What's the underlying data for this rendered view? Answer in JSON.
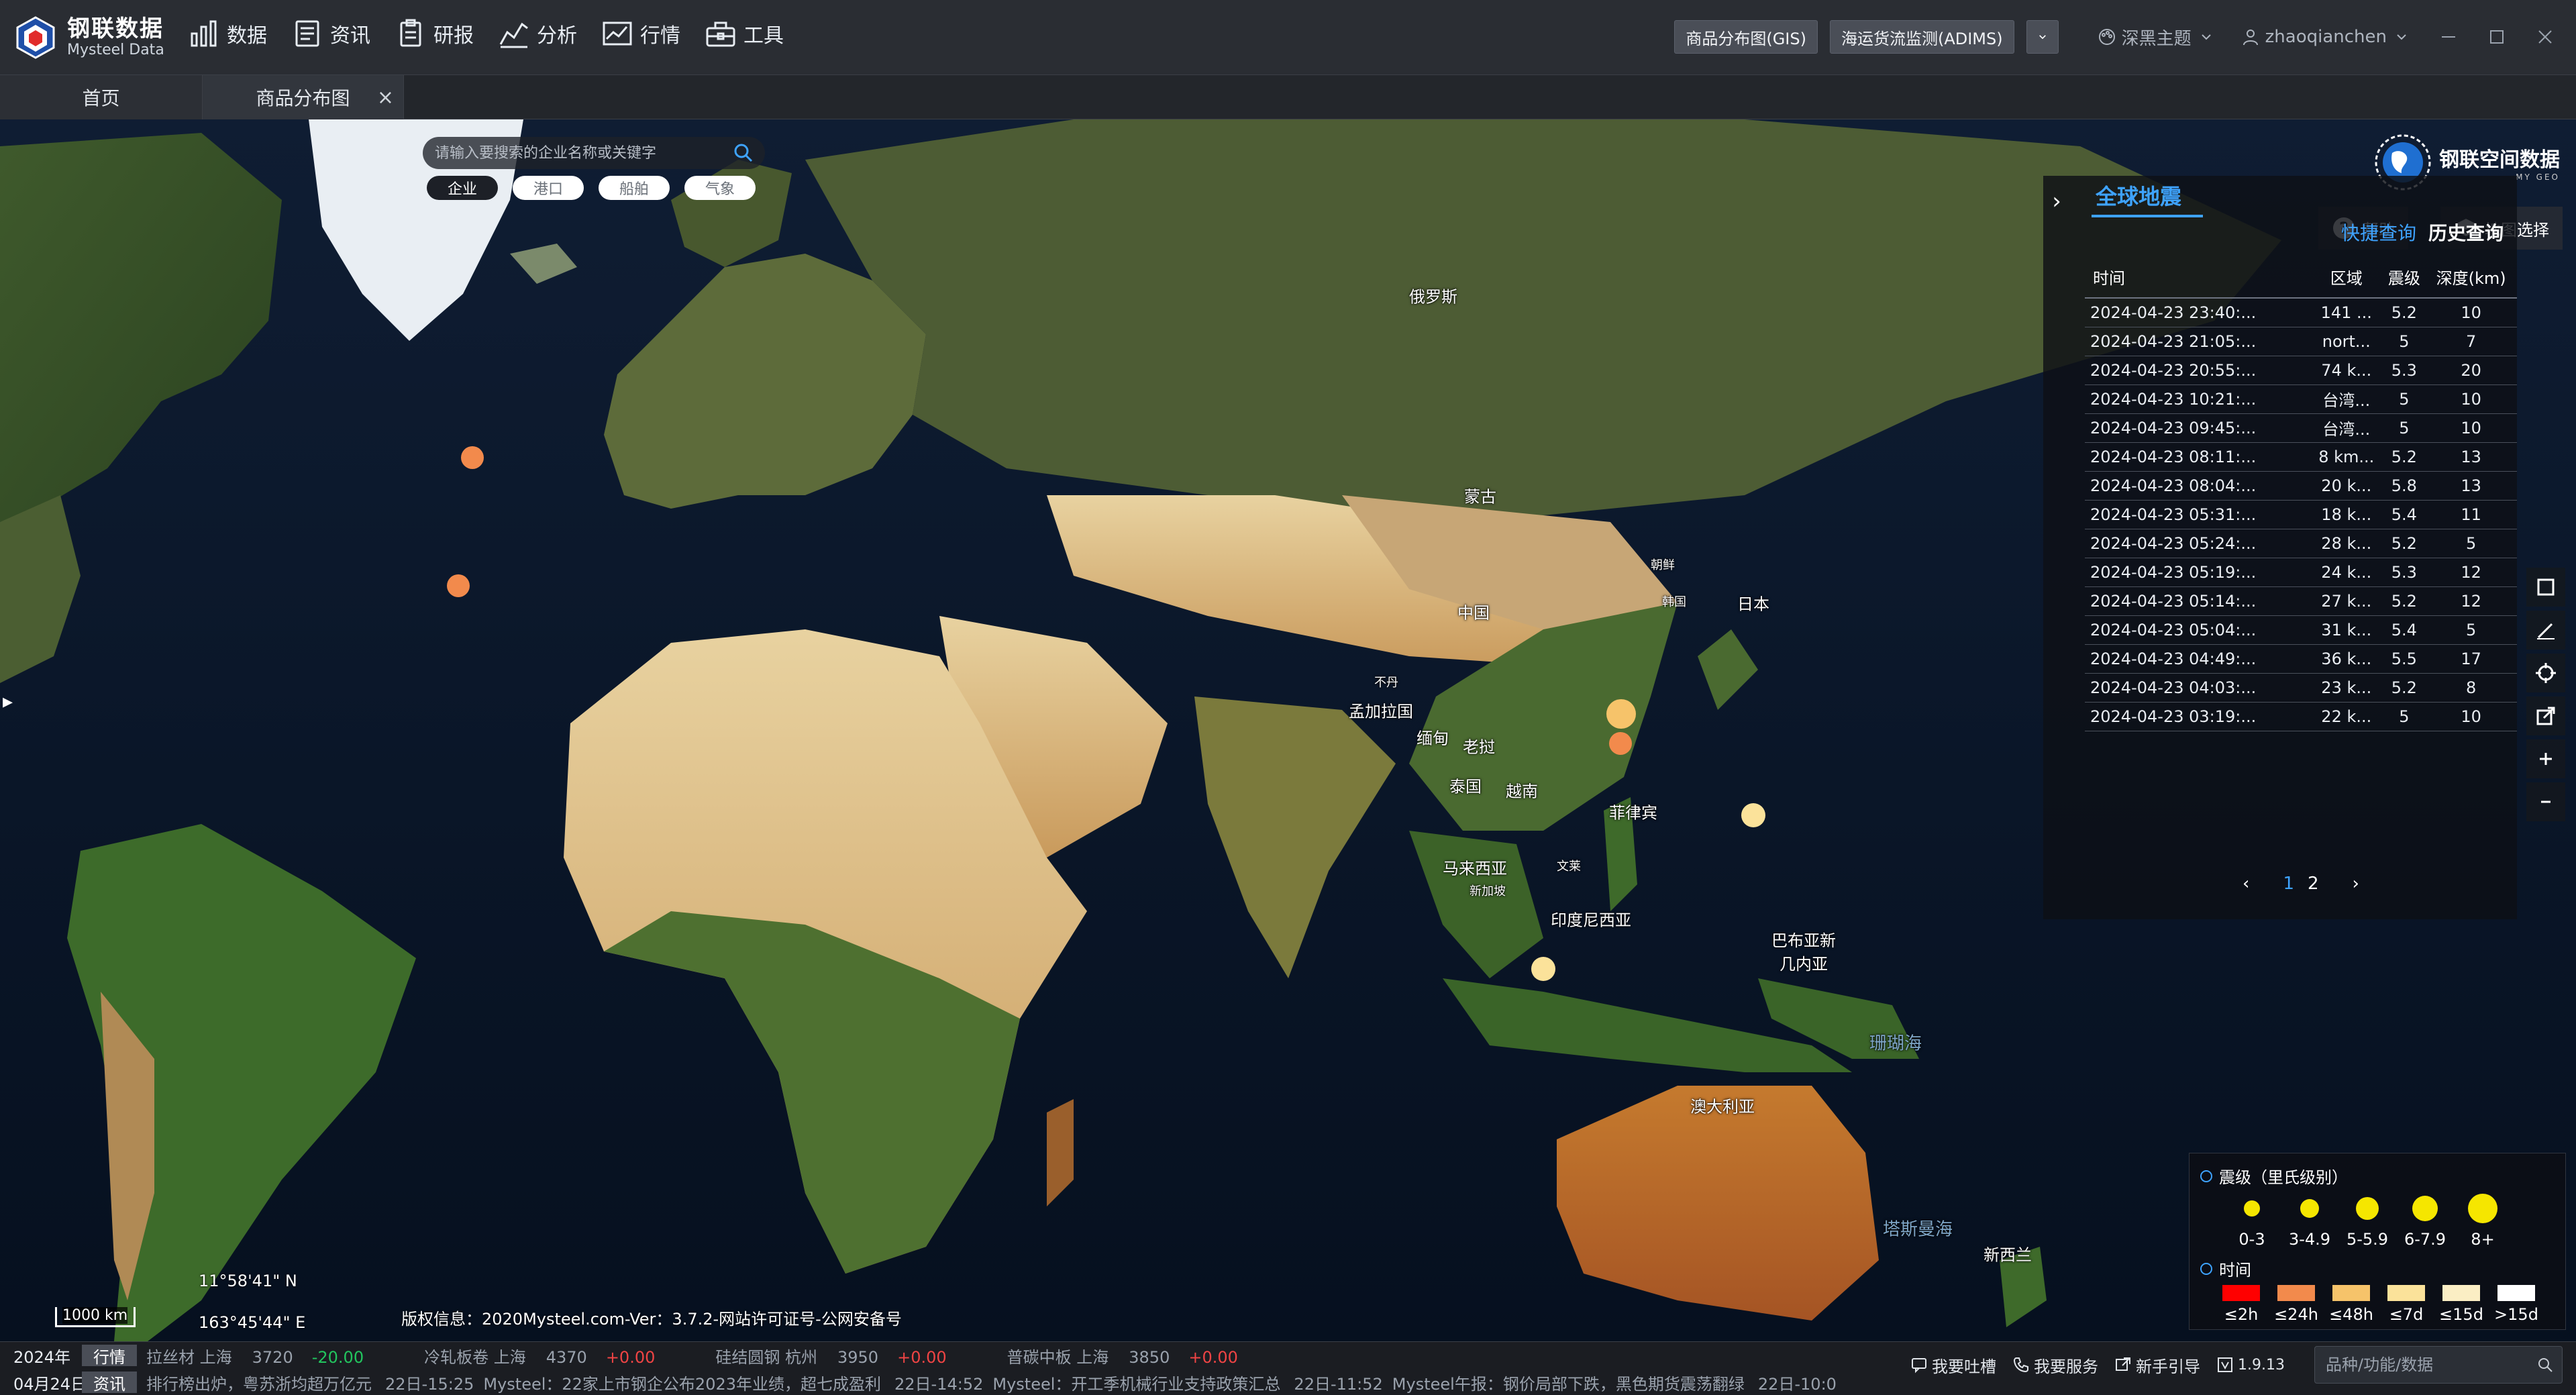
{
  "app": {
    "logo_cn": "钢联数据",
    "logo_en": "Mysteel Data"
  },
  "nav": [
    {
      "label": "数据",
      "icon": "data-chart-icon"
    },
    {
      "label": "资讯",
      "icon": "news-icon"
    },
    {
      "label": "研报",
      "icon": "report-icon"
    },
    {
      "label": "分析",
      "icon": "analysis-icon"
    },
    {
      "label": "行情",
      "icon": "market-icon"
    },
    {
      "label": "工具",
      "icon": "toolbox-icon"
    }
  ],
  "header_right": {
    "btn_gis": "商品分布图(GIS)",
    "btn_adims": "海运货流监测(ADIMS)",
    "theme": "深黑主题",
    "user": "zhaoqianchen"
  },
  "tabs": {
    "home": "首页",
    "gis": "商品分布图",
    "close": "×"
  },
  "map": {
    "search_placeholder": "请输入要搜索的企业名称或关键字",
    "categories": [
      "企业",
      "港口",
      "船舶",
      "气象"
    ],
    "brand": "钢联空间数据",
    "brand_sub": "MY GEO",
    "help": "帮助",
    "layer_select": "地图选择",
    "places": {
      "russia": "俄罗斯",
      "mongolia": "蒙古",
      "china": "中国",
      "japan": "日本",
      "korea": "韩国",
      "north_korea": "朝鲜",
      "bhutan": "不丹",
      "bangladesh": "孟加拉国",
      "myanmar": "缅甸",
      "laos": "老挝",
      "thailand": "泰国",
      "vietnam": "越南",
      "philippines": "菲律宾",
      "malaysia": "马来西亚",
      "brunei": "文莱",
      "singapore": "新加坡",
      "indonesia": "印度尼西亚",
      "png": "巴布亚新\n几内亚",
      "coral_sea": "珊瑚海",
      "australia": "澳大利亚",
      "tasman_sea": "塔斯曼海",
      "new_zealand": "新西兰"
    },
    "lat": "11°58'41\" N",
    "lon": "163°45'44\" E",
    "scale": "1000 km",
    "copyright": "版权信息：2020Mysteel.com-Ver：3.7.2-网站许可证号-公网安备号",
    "left_toggle": "▸"
  },
  "earthquake": {
    "title": "全球地震",
    "tab_quick": "快捷查询",
    "tab_history": "历史查询",
    "columns": [
      "时间",
      "区域",
      "震级",
      "深度(km)"
    ],
    "rows": [
      [
        "2024-04-23 23:40:...",
        "141 ...",
        "5.2",
        "10"
      ],
      [
        "2024-04-23 21:05:...",
        "nort...",
        "5",
        "7"
      ],
      [
        "2024-04-23 20:55:...",
        "74 k...",
        "5.3",
        "20"
      ],
      [
        "2024-04-23 10:21:...",
        "台湾...",
        "5",
        "10"
      ],
      [
        "2024-04-23 09:45:...",
        "台湾...",
        "5",
        "10"
      ],
      [
        "2024-04-23 08:11:...",
        "8 km...",
        "5.2",
        "13"
      ],
      [
        "2024-04-23 08:04:...",
        "20 k...",
        "5.8",
        "13"
      ],
      [
        "2024-04-23 05:31:...",
        "18 k...",
        "5.4",
        "11"
      ],
      [
        "2024-04-23 05:24:...",
        "28 k...",
        "5.2",
        "5"
      ],
      [
        "2024-04-23 05:19:...",
        "24 k...",
        "5.3",
        "12"
      ],
      [
        "2024-04-23 05:14:...",
        "27 k...",
        "5.2",
        "12"
      ],
      [
        "2024-04-23 05:04:...",
        "31 k...",
        "5.4",
        "5"
      ],
      [
        "2024-04-23 04:49:...",
        "36 k...",
        "5.5",
        "17"
      ],
      [
        "2024-04-23 04:03:...",
        "23 k...",
        "5.2",
        "8"
      ],
      [
        "2024-04-23 03:19:...",
        "22 k...",
        "5",
        "10"
      ]
    ],
    "pager": {
      "prev": "‹",
      "pages": [
        "1",
        "2"
      ],
      "current": "1",
      "next": "›"
    },
    "collapse": "›"
  },
  "legend": {
    "magnitude_title": "震级（里氏级别）",
    "magnitude_levels": [
      "0-3",
      "3-4.9",
      "5-5.9",
      "6-7.9",
      "8+"
    ],
    "time_title": "时间",
    "time_levels": [
      {
        "label": "≤2h",
        "color": "#ff0000"
      },
      {
        "label": "≤24h",
        "color": "#f28a4c"
      },
      {
        "label": "≤48h",
        "color": "#f6c36a"
      },
      {
        "label": "≤7d",
        "color": "#fbe29a"
      },
      {
        "label": "≤15d",
        "color": "#fbeec4"
      },
      {
        "label": ">15d",
        "color": "#ffffff"
      }
    ]
  },
  "ticker": {
    "year": "2024年",
    "date": "04月24日",
    "tag_market": "行情",
    "tag_news": "资讯",
    "quotes": [
      {
        "name": "拉丝材 上海",
        "price": "3720",
        "change": "-20.00",
        "dir": "neg"
      },
      {
        "name": "冷轧板卷 上海",
        "price": "4370",
        "change": "+0.00",
        "dir": "pos"
      },
      {
        "name": "硅结圆钢 杭州",
        "price": "3950",
        "change": "+0.00",
        "dir": "pos"
      },
      {
        "name": "普碳中板 上海",
        "price": "3850",
        "change": "+0.00",
        "dir": "pos"
      }
    ],
    "news": [
      {
        "time": "",
        "text": "排行榜出炉，粤苏浙均超万亿元"
      },
      {
        "time": "22日-15:25",
        "text": "Mysteel：22家上市钢企公布2023年业绩，超七成盈利"
      },
      {
        "time": "22日-14:52",
        "text": "Mysteel：开工季机械行业支持政策汇总"
      },
      {
        "time": "22日-11:52",
        "text": "Mysteel午报：钢价局部下跌，黑色期货震荡翻绿"
      },
      {
        "time": "22日-10:0",
        "text": ""
      }
    ],
    "feedback": "我要吐槽",
    "service": "我要服务",
    "guide": "新手引导",
    "version": "1.9.13",
    "search_placeholder": "品种/功能/数据"
  }
}
